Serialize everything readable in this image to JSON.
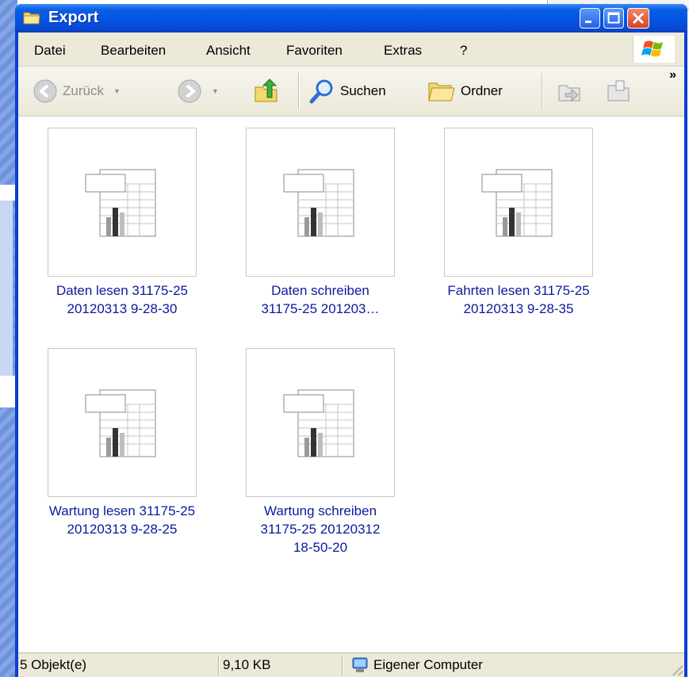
{
  "window": {
    "title": "Export"
  },
  "menu": {
    "items": [
      {
        "label": "Datei"
      },
      {
        "label": "Bearbeiten"
      },
      {
        "label": "Ansicht"
      },
      {
        "label": "Favoriten"
      },
      {
        "label": "Extras"
      },
      {
        "label": "?"
      }
    ]
  },
  "toolbar": {
    "back_label": "Zurück",
    "search_label": "Suchen",
    "folders_label": "Ordner",
    "overflow_label": "»"
  },
  "files": [
    {
      "name_line1": "Daten lesen 31175-25",
      "name_line2": "20120313 9-28-30",
      "name_line3": ""
    },
    {
      "name_line1": "Daten schreiben",
      "name_line2": "31175-25 201203…",
      "name_line3": ""
    },
    {
      "name_line1": "Fahrten lesen 31175-25",
      "name_line2": "20120313 9-28-35",
      "name_line3": ""
    },
    {
      "name_line1": "Wartung lesen 31175-25",
      "name_line2": "20120313 9-28-25",
      "name_line3": ""
    },
    {
      "name_line1": "Wartung schreiben",
      "name_line2": "31175-25 20120312",
      "name_line3": "18-50-20"
    }
  ],
  "status": {
    "object_count": "5 Objekt(e)",
    "size": "9,10 KB",
    "zone": "Eigener Computer"
  },
  "colors": {
    "title_bar": "#0054e3",
    "chrome": "#ece9d8",
    "file_label": "#0a1a9c"
  }
}
